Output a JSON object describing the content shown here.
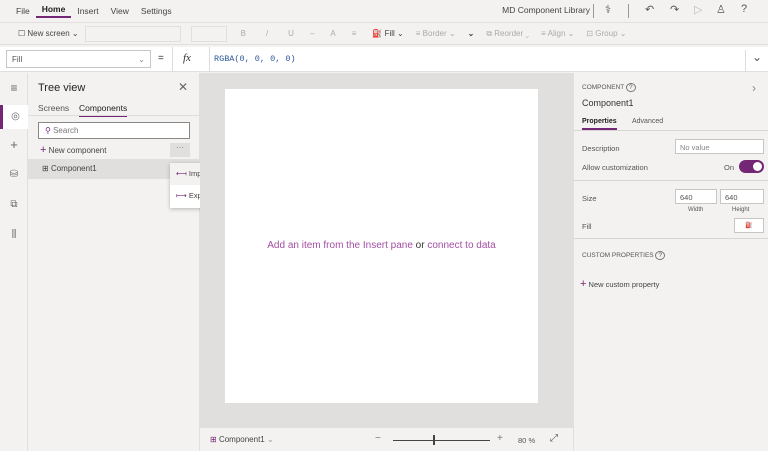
{
  "menu": {
    "items": [
      "File",
      "Home",
      "Insert",
      "View",
      "Settings"
    ],
    "active": "Home",
    "app_title": "MD Component Library"
  },
  "toolbar": {
    "new_screen": "New screen",
    "fill": "Fill",
    "border": "Border",
    "reorder": "Reorder",
    "align": "Align",
    "group": "Group",
    "bold": "B",
    "italic": "/",
    "underline": "U",
    "font_color": "A"
  },
  "formula": {
    "property": "Fill",
    "equals": "=",
    "fx": "fx",
    "value": "RGBA(0, 0, 0, 0)"
  },
  "tree": {
    "title": "Tree view",
    "tabs": [
      "Screens",
      "Components"
    ],
    "active_tab": "Components",
    "search_placeholder": "Search",
    "new_component": "New component",
    "items": [
      "Component1"
    ]
  },
  "context_menu": {
    "items": [
      "Import components",
      "Export components"
    ]
  },
  "canvas": {
    "hint_prefix": "Add an item from the Insert pane",
    "hint_or": "or",
    "hint_link": "connect to data"
  },
  "bottom": {
    "screen": "Component1",
    "zoom_percent": 80,
    "zoom_label": "80",
    "percent_sign": "%",
    "slider_fraction": 0.41
  },
  "panel": {
    "section": "COMPONENT",
    "name": "Component1",
    "tabs": [
      "Properties",
      "Advanced"
    ],
    "active_tab": "Properties",
    "description_label": "Description",
    "description_placeholder": "No value",
    "allow_label": "Allow customization",
    "allow_state": "On",
    "allow_value": true,
    "size_label": "Size",
    "width": "640",
    "height": "640",
    "width_label": "Width",
    "height_label": "Height",
    "fill_label": "Fill",
    "custom_props": "CUSTOM PROPERTIES",
    "new_custom": "New custom property"
  },
  "colors": {
    "accent": "#742774",
    "link": "#a24ea2"
  }
}
